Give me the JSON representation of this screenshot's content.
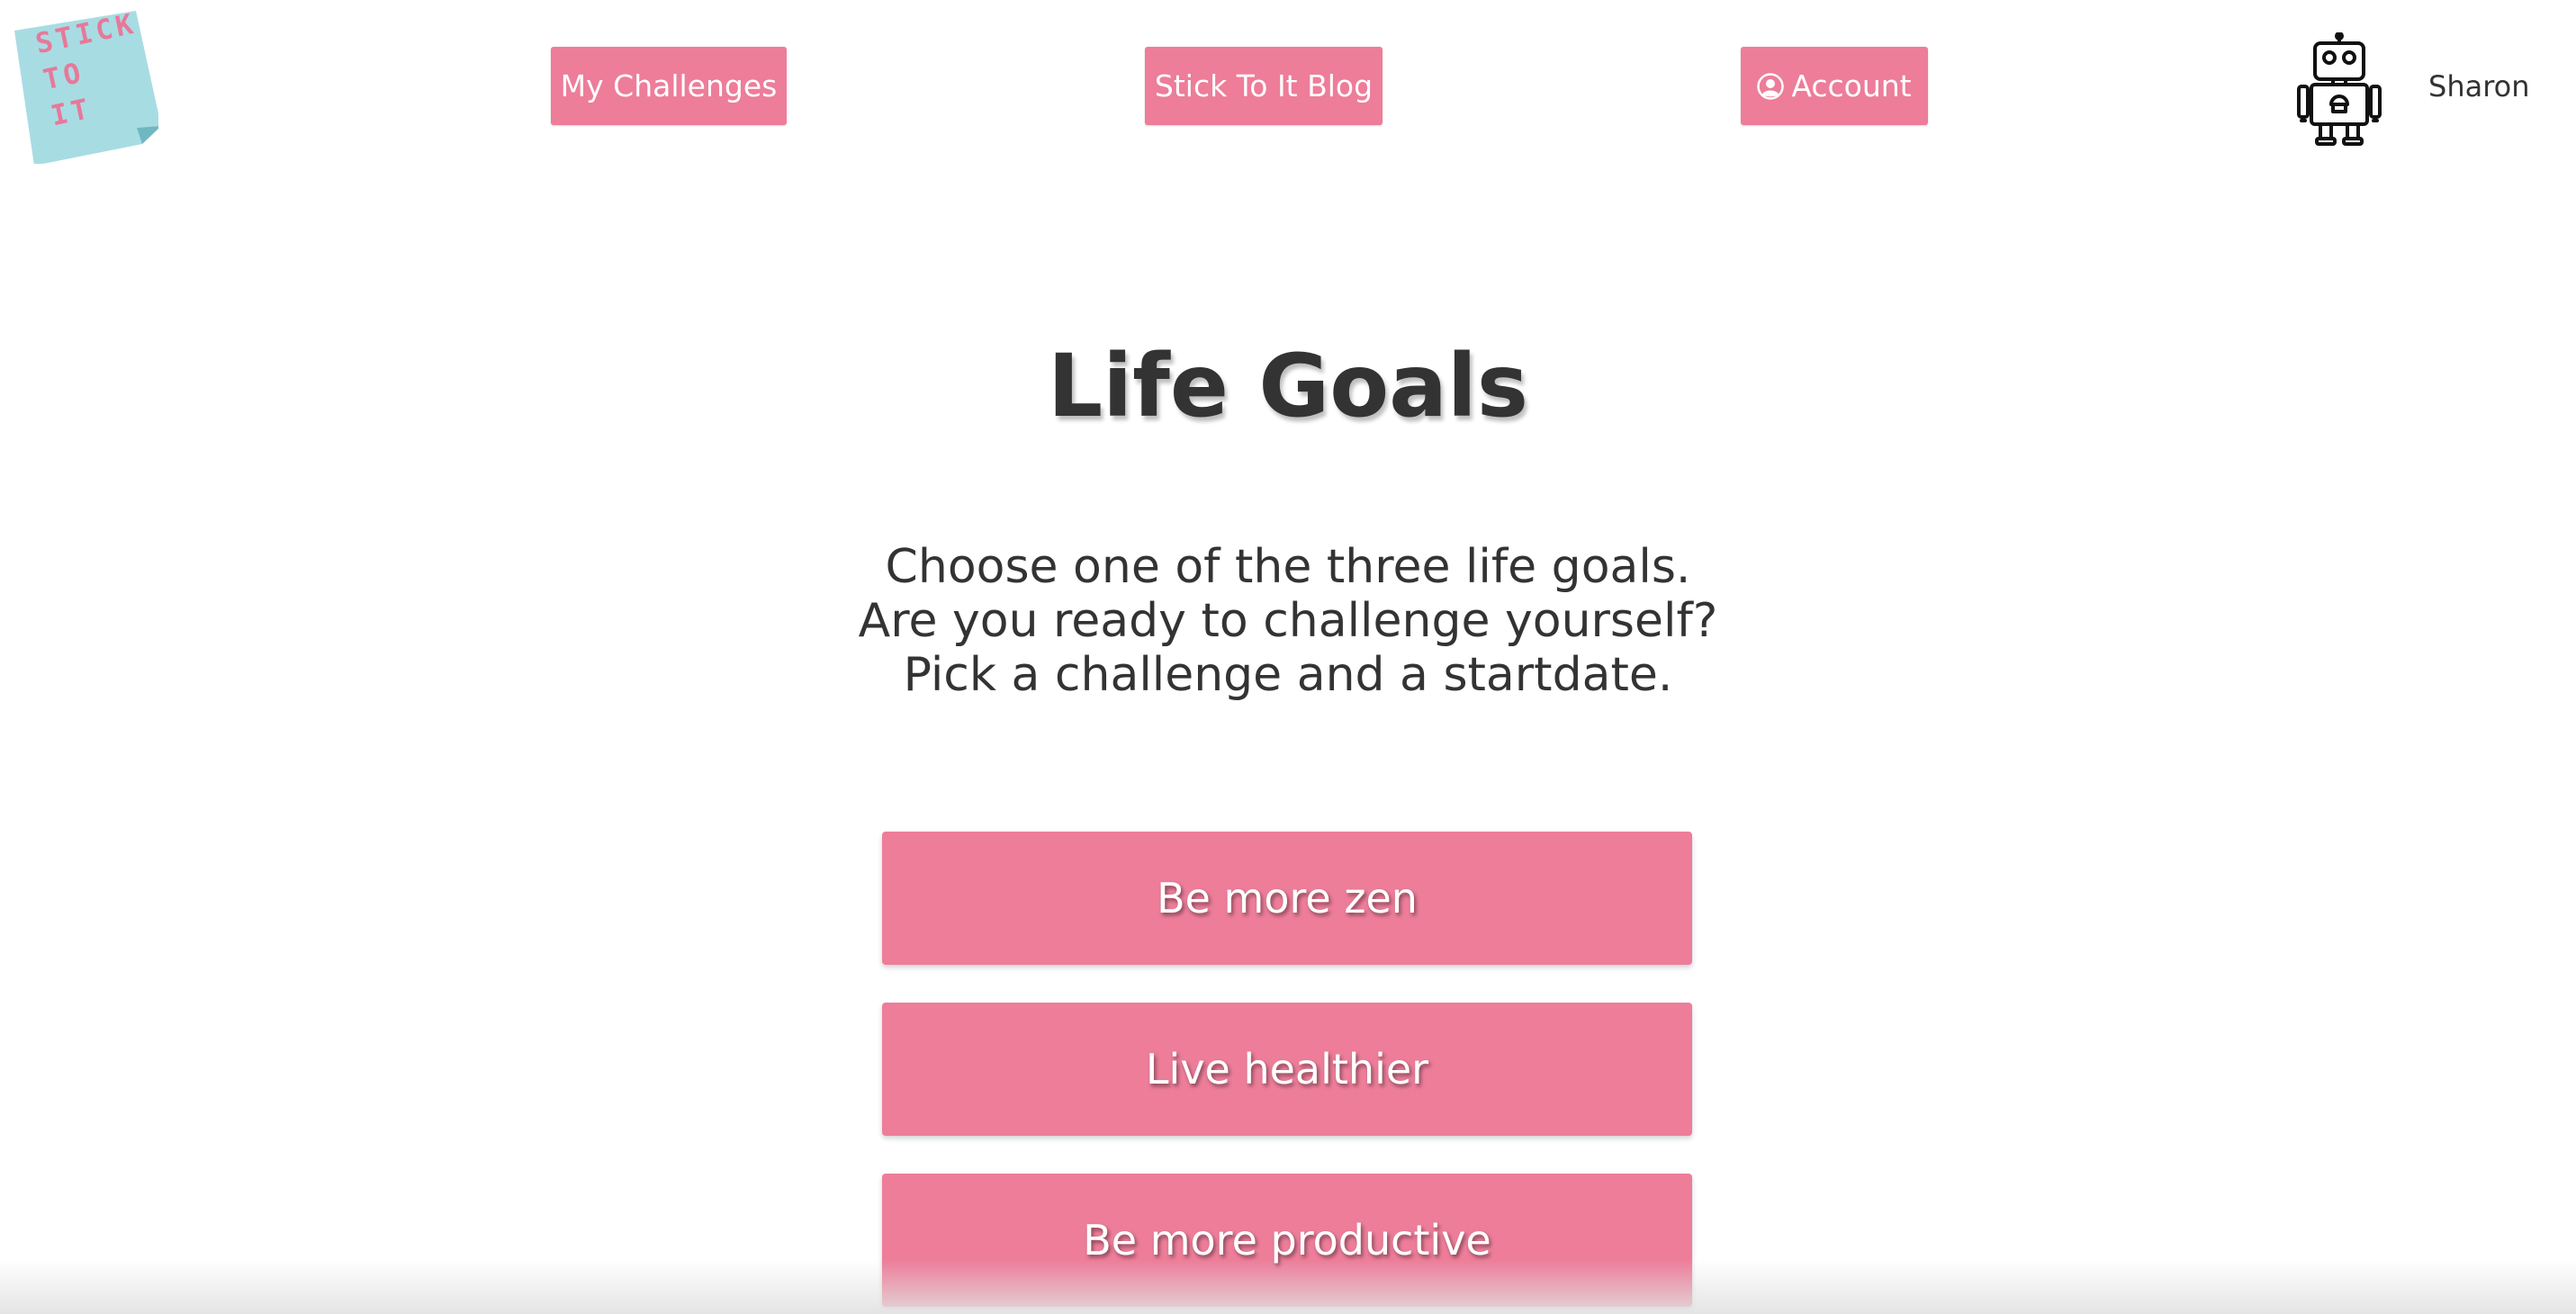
{
  "logo": {
    "text": "STICK\nTO\nIT",
    "background_color": "#a8dce3"
  },
  "nav": {
    "my_challenges_label": "My Challenges",
    "blog_label": "Stick To It Blog",
    "account_label": "Account",
    "account_icon": "user-circle-icon",
    "button_color": "#ed7d99"
  },
  "user": {
    "avatar_icon": "robot-icon",
    "name": "Sharon"
  },
  "main": {
    "title": "Life Goals",
    "intro_lines": [
      "Choose one of the three life goals.",
      "Are you ready to challenge yourself?",
      "Pick a challenge and a startdate."
    ],
    "goals": [
      {
        "label": "Be more zen"
      },
      {
        "label": "Live healthier"
      },
      {
        "label": "Be more productive"
      }
    ]
  }
}
